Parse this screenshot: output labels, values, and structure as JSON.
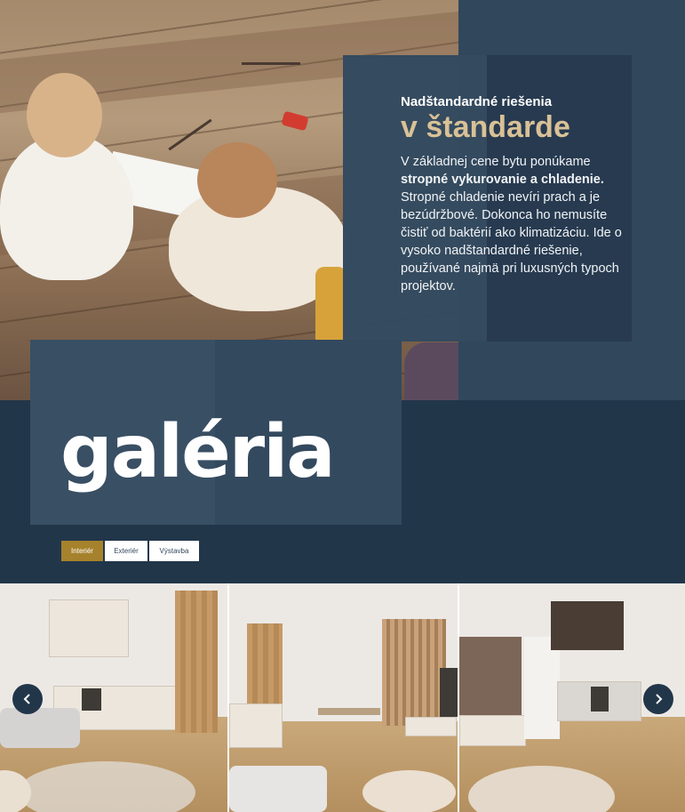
{
  "feature": {
    "kicker": "Nadštandardné riešenia",
    "title": "v štandarde",
    "body_lead": "V základnej cene bytu ponúkame ",
    "body_bold": "stropné vykurovanie a chladenie.",
    "body_rest": " Stropné chladenie nevíri prach a je bezúdržbové. Dokonca ho nemusíte čistiť od baktérií ako klimatizáciu. Ide o vysoko nadštandardné riešenie, používané najmä pri luxusných typoch projektov."
  },
  "gallery": {
    "title": "galéria",
    "tabs": [
      {
        "label": "Interiér",
        "active": true
      },
      {
        "label": "Exteriér",
        "active": false
      },
      {
        "label": "Výstavba",
        "active": false
      }
    ]
  },
  "carousel": {
    "prev_icon": "chevron-left-icon",
    "next_icon": "chevron-right-icon"
  },
  "colors": {
    "navy": "#22364a",
    "accent_gold": "#a6822c",
    "title_beige": "#d9c196"
  }
}
